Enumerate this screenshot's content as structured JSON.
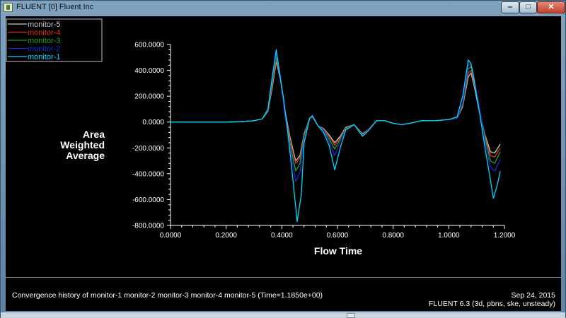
{
  "window": {
    "title": "FLUENT [0] Fluent Inc",
    "minimize_label": "‒",
    "maximize_label": "□",
    "close_label": "✕"
  },
  "info": {
    "description": "Convergence history of monitor-1 monitor-2 monitor-3 monitor-4 monitor-5  (Time=1.1850e+00)",
    "date": "Sep 24, 2015",
    "solver": "FLUENT 6.3 (3d, pbns, ske, unsteady)"
  },
  "colors": {
    "background": "#000000",
    "axes": "#ffffff",
    "monitor-1": "#00d8ff",
    "monitor-2": "#1a2bd6",
    "monitor-3": "#1fa31f",
    "monitor-4": "#e03020",
    "monitor-5": "#c8c8c8"
  },
  "chart_data": {
    "type": "line",
    "xlabel": "Flow Time",
    "ylabel": "Area Weighted Average",
    "xlim": [
      0,
      1.2
    ],
    "ylim": [
      -800,
      600
    ],
    "xticks": [
      "0.0000",
      "0.2000",
      "0.4000",
      "0.6000",
      "0.8000",
      "1.0000",
      "1.2000"
    ],
    "yticks": [
      "600.0000",
      "400.0000",
      "200.0000",
      "0.0000",
      "-200.0000",
      "-400.0000",
      "-600.0000",
      "-800.0000"
    ],
    "legend_position": "top-left",
    "grid": false,
    "series": [
      {
        "name": "monitor-5",
        "color": "#c8c8c8",
        "points": [
          [
            0,
            0
          ],
          [
            0.1,
            0
          ],
          [
            0.2,
            0
          ],
          [
            0.25,
            3
          ],
          [
            0.3,
            10
          ],
          [
            0.33,
            25
          ],
          [
            0.35,
            80
          ],
          [
            0.365,
            260
          ],
          [
            0.38,
            470
          ],
          [
            0.395,
            330
          ],
          [
            0.41,
            100
          ],
          [
            0.43,
            -120
          ],
          [
            0.45,
            -300
          ],
          [
            0.465,
            -260
          ],
          [
            0.48,
            -90
          ],
          [
            0.5,
            30
          ],
          [
            0.51,
            40
          ],
          [
            0.53,
            -30
          ],
          [
            0.55,
            -50
          ],
          [
            0.57,
            -100
          ],
          [
            0.59,
            -160
          ],
          [
            0.61,
            -110
          ],
          [
            0.63,
            -40
          ],
          [
            0.66,
            -20
          ],
          [
            0.69,
            -90
          ],
          [
            0.71,
            -60
          ],
          [
            0.74,
            10
          ],
          [
            0.77,
            10
          ],
          [
            0.8,
            -10
          ],
          [
            0.83,
            -20
          ],
          [
            0.86,
            -10
          ],
          [
            0.9,
            10
          ],
          [
            0.95,
            10
          ],
          [
            1.0,
            20
          ],
          [
            1.03,
            30
          ],
          [
            1.05,
            120
          ],
          [
            1.07,
            350
          ],
          [
            1.08,
            380
          ],
          [
            1.09,
            290
          ],
          [
            1.11,
            80
          ],
          [
            1.13,
            -100
          ],
          [
            1.15,
            -230
          ],
          [
            1.165,
            -240
          ],
          [
            1.185,
            -170
          ]
        ]
      },
      {
        "name": "monitor-4",
        "color": "#e03020",
        "points": [
          [
            0,
            0
          ],
          [
            0.1,
            0
          ],
          [
            0.2,
            0
          ],
          [
            0.25,
            3
          ],
          [
            0.3,
            10
          ],
          [
            0.33,
            25
          ],
          [
            0.35,
            85
          ],
          [
            0.365,
            280
          ],
          [
            0.38,
            490
          ],
          [
            0.395,
            340
          ],
          [
            0.41,
            90
          ],
          [
            0.43,
            -140
          ],
          [
            0.45,
            -320
          ],
          [
            0.465,
            -280
          ],
          [
            0.48,
            -100
          ],
          [
            0.5,
            30
          ],
          [
            0.51,
            45
          ],
          [
            0.53,
            -30
          ],
          [
            0.55,
            -55
          ],
          [
            0.57,
            -110
          ],
          [
            0.59,
            -180
          ],
          [
            0.61,
            -120
          ],
          [
            0.63,
            -45
          ],
          [
            0.66,
            -20
          ],
          [
            0.69,
            -95
          ],
          [
            0.71,
            -60
          ],
          [
            0.74,
            10
          ],
          [
            0.77,
            10
          ],
          [
            0.8,
            -10
          ],
          [
            0.83,
            -20
          ],
          [
            0.86,
            -10
          ],
          [
            0.9,
            10
          ],
          [
            0.95,
            10
          ],
          [
            1.0,
            20
          ],
          [
            1.03,
            30
          ],
          [
            1.05,
            130
          ],
          [
            1.07,
            380
          ],
          [
            1.08,
            400
          ],
          [
            1.09,
            310
          ],
          [
            1.11,
            90
          ],
          [
            1.13,
            -110
          ],
          [
            1.15,
            -260
          ],
          [
            1.165,
            -270
          ],
          [
            1.185,
            -200
          ]
        ]
      },
      {
        "name": "monitor-3",
        "color": "#1fa31f",
        "points": [
          [
            0,
            0
          ],
          [
            0.1,
            0
          ],
          [
            0.2,
            0
          ],
          [
            0.25,
            3
          ],
          [
            0.3,
            10
          ],
          [
            0.33,
            25
          ],
          [
            0.35,
            90
          ],
          [
            0.365,
            300
          ],
          [
            0.38,
            510
          ],
          [
            0.395,
            350
          ],
          [
            0.41,
            80
          ],
          [
            0.43,
            -170
          ],
          [
            0.45,
            -380
          ],
          [
            0.465,
            -320
          ],
          [
            0.48,
            -110
          ],
          [
            0.5,
            30
          ],
          [
            0.51,
            45
          ],
          [
            0.53,
            -30
          ],
          [
            0.55,
            -60
          ],
          [
            0.57,
            -130
          ],
          [
            0.59,
            -210
          ],
          [
            0.61,
            -130
          ],
          [
            0.63,
            -50
          ],
          [
            0.66,
            -20
          ],
          [
            0.69,
            -100
          ],
          [
            0.71,
            -65
          ],
          [
            0.74,
            10
          ],
          [
            0.77,
            10
          ],
          [
            0.8,
            -10
          ],
          [
            0.83,
            -20
          ],
          [
            0.86,
            -10
          ],
          [
            0.9,
            10
          ],
          [
            0.95,
            10
          ],
          [
            1.0,
            20
          ],
          [
            1.03,
            30
          ],
          [
            1.05,
            140
          ],
          [
            1.07,
            410
          ],
          [
            1.08,
            430
          ],
          [
            1.09,
            330
          ],
          [
            1.11,
            100
          ],
          [
            1.13,
            -120
          ],
          [
            1.15,
            -300
          ],
          [
            1.165,
            -320
          ],
          [
            1.185,
            -230
          ]
        ]
      },
      {
        "name": "monitor-2",
        "color": "#1a2bd6",
        "points": [
          [
            0,
            0
          ],
          [
            0.1,
            0
          ],
          [
            0.2,
            0
          ],
          [
            0.25,
            3
          ],
          [
            0.3,
            10
          ],
          [
            0.33,
            25
          ],
          [
            0.35,
            95
          ],
          [
            0.365,
            320
          ],
          [
            0.38,
            530
          ],
          [
            0.395,
            360
          ],
          [
            0.41,
            70
          ],
          [
            0.43,
            -200
          ],
          [
            0.45,
            -460
          ],
          [
            0.465,
            -390
          ],
          [
            0.48,
            -130
          ],
          [
            0.5,
            30
          ],
          [
            0.51,
            45
          ],
          [
            0.53,
            -30
          ],
          [
            0.55,
            -65
          ],
          [
            0.57,
            -150
          ],
          [
            0.59,
            -260
          ],
          [
            0.61,
            -145
          ],
          [
            0.63,
            -55
          ],
          [
            0.66,
            -20
          ],
          [
            0.69,
            -105
          ],
          [
            0.71,
            -65
          ],
          [
            0.74,
            10
          ],
          [
            0.77,
            10
          ],
          [
            0.8,
            -10
          ],
          [
            0.83,
            -20
          ],
          [
            0.86,
            -10
          ],
          [
            0.9,
            10
          ],
          [
            0.95,
            10
          ],
          [
            1.0,
            20
          ],
          [
            1.03,
            30
          ],
          [
            1.05,
            150
          ],
          [
            1.07,
            440
          ],
          [
            1.08,
            450
          ],
          [
            1.09,
            350
          ],
          [
            1.11,
            110
          ],
          [
            1.13,
            -150
          ],
          [
            1.15,
            -350
          ],
          [
            1.165,
            -380
          ],
          [
            1.185,
            -290
          ]
        ]
      },
      {
        "name": "monitor-1",
        "color": "#00d8ff",
        "points": [
          [
            0,
            0
          ],
          [
            0.1,
            0
          ],
          [
            0.2,
            0
          ],
          [
            0.25,
            3
          ],
          [
            0.3,
            10
          ],
          [
            0.33,
            25
          ],
          [
            0.35,
            100
          ],
          [
            0.365,
            340
          ],
          [
            0.38,
            560
          ],
          [
            0.395,
            330
          ],
          [
            0.405,
            200
          ],
          [
            0.42,
            -50
          ],
          [
            0.44,
            -450
          ],
          [
            0.455,
            -770
          ],
          [
            0.47,
            -560
          ],
          [
            0.48,
            -160
          ],
          [
            0.5,
            30
          ],
          [
            0.51,
            50
          ],
          [
            0.53,
            -30
          ],
          [
            0.55,
            -80
          ],
          [
            0.57,
            -180
          ],
          [
            0.59,
            -370
          ],
          [
            0.61,
            -200
          ],
          [
            0.63,
            -60
          ],
          [
            0.66,
            -20
          ],
          [
            0.69,
            -110
          ],
          [
            0.71,
            -70
          ],
          [
            0.74,
            10
          ],
          [
            0.77,
            10
          ],
          [
            0.8,
            -10
          ],
          [
            0.83,
            -20
          ],
          [
            0.86,
            -10
          ],
          [
            0.9,
            10
          ],
          [
            0.95,
            10
          ],
          [
            1.0,
            20
          ],
          [
            1.03,
            40
          ],
          [
            1.05,
            200
          ],
          [
            1.07,
            480
          ],
          [
            1.08,
            450
          ],
          [
            1.09,
            340
          ],
          [
            1.1,
            200
          ],
          [
            1.11,
            80
          ],
          [
            1.13,
            -200
          ],
          [
            1.15,
            -450
          ],
          [
            1.16,
            -590
          ],
          [
            1.175,
            -480
          ],
          [
            1.185,
            -380
          ]
        ]
      }
    ]
  }
}
